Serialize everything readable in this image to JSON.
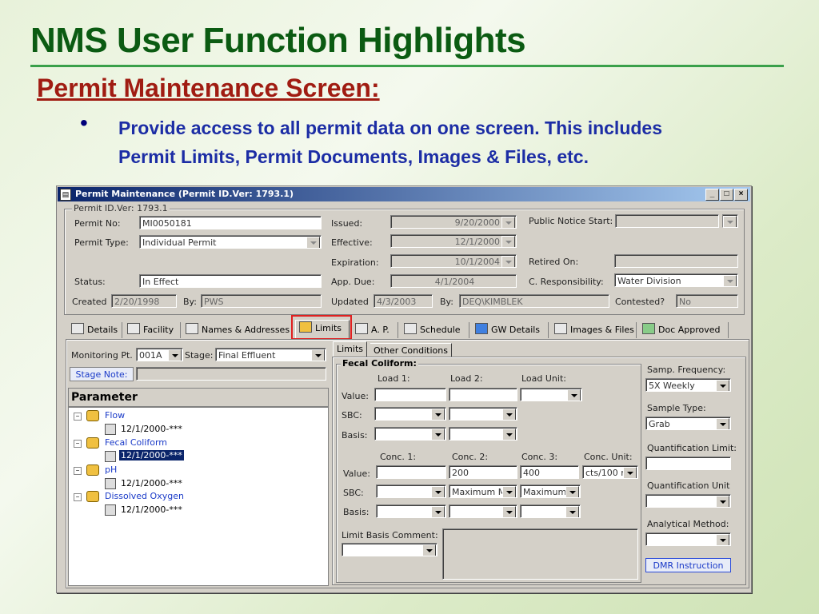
{
  "slide": {
    "title": "NMS User Function Highlights",
    "subtitle": "Permit Maintenance Screen:",
    "bullet_line1": "Provide access to all permit data on one screen.  This includes",
    "bullet_line2": "Permit Limits, Permit Documents, Images & Files, etc."
  },
  "window": {
    "title": "Permit Maintenance (Permit ID.Ver: 1793.1)",
    "min": "_",
    "max": "□",
    "close": "×"
  },
  "header": {
    "group_label": "Permit ID.Ver: 1793.1",
    "permit_no_label": "Permit No:",
    "permit_no": "MI0050181",
    "permit_type_label": "Permit Type:",
    "permit_type": "Individual Permit",
    "status_label": "Status:",
    "status": "In Effect",
    "created_label": "Created",
    "created": "2/20/1998",
    "by_label": "By:",
    "created_by": "PWS",
    "issued_label": "Issued:",
    "issued": "9/20/2000",
    "effective_label": "Effective:",
    "effective": "12/1/2000",
    "expiration_label": "Expiration:",
    "expiration": "10/1/2004",
    "app_due_label": "App. Due:",
    "app_due": "4/1/2004",
    "updated_label": "Updated",
    "updated": "4/3/2003",
    "updated_by_label": "By:",
    "updated_by": "DEQ\\KIMBLEK",
    "public_notice_label": "Public Notice Start:",
    "public_notice": "",
    "retired_label": "Retired On:",
    "retired": "",
    "c_resp_label": "C. Responsibility:",
    "c_resp": "Water Division",
    "contested_label": "Contested?",
    "contested": "No"
  },
  "tabs": [
    {
      "label": "Details"
    },
    {
      "label": "Facility"
    },
    {
      "label": "Names & Addresses"
    },
    {
      "label": "Limits"
    },
    {
      "label": "A. P."
    },
    {
      "label": "Schedule"
    },
    {
      "label": "GW Details"
    },
    {
      "label": "Images & Files"
    },
    {
      "label": "Doc Approved"
    }
  ],
  "left": {
    "monitoring_label": "Monitoring Pt.",
    "monitoring": "001A",
    "stage_label": "Stage:",
    "stage": "Final Effluent",
    "stage_note_button": "Stage Note:",
    "parameter_header": "Parameter",
    "tree": [
      {
        "name": "Flow",
        "date": "12/1/2000-***"
      },
      {
        "name": "Fecal Coliform",
        "date": "12/1/2000-***"
      },
      {
        "name": "pH",
        "date": "12/1/2000-***"
      },
      {
        "name": "Dissolved Oxygen",
        "date": "12/1/2000-***"
      }
    ]
  },
  "right": {
    "subtab_limits": "Limits",
    "subtab_other": "Other Conditions",
    "group_label": "Fecal Coliform:",
    "load1": "Load 1:",
    "load2": "Load 2:",
    "load_unit": "Load Unit:",
    "value_label": "Value:",
    "sbc_label": "SBC:",
    "basis_label": "Basis:",
    "conc1": "Conc. 1:",
    "conc2": "Conc. 2:",
    "conc3": "Conc. 3:",
    "conc_unit": "Conc. Unit:",
    "conc2_value": "200",
    "conc3_value": "400",
    "conc_unit_value": "cts/100 r",
    "conc2_sbc": "Maximum M",
    "conc3_sbc": "Maximum",
    "limit_basis_comment": "Limit Basis Comment:",
    "samp_freq_label": "Samp. Frequency:",
    "samp_freq": "5X Weekly",
    "sample_type_label": "Sample Type:",
    "sample_type": "Grab",
    "quant_limit_label": "Quantification Limit:",
    "quant_unit_label": "Quantification Unit",
    "analytical_label": "Analytical Method:",
    "dmr_button": "DMR Instruction"
  }
}
